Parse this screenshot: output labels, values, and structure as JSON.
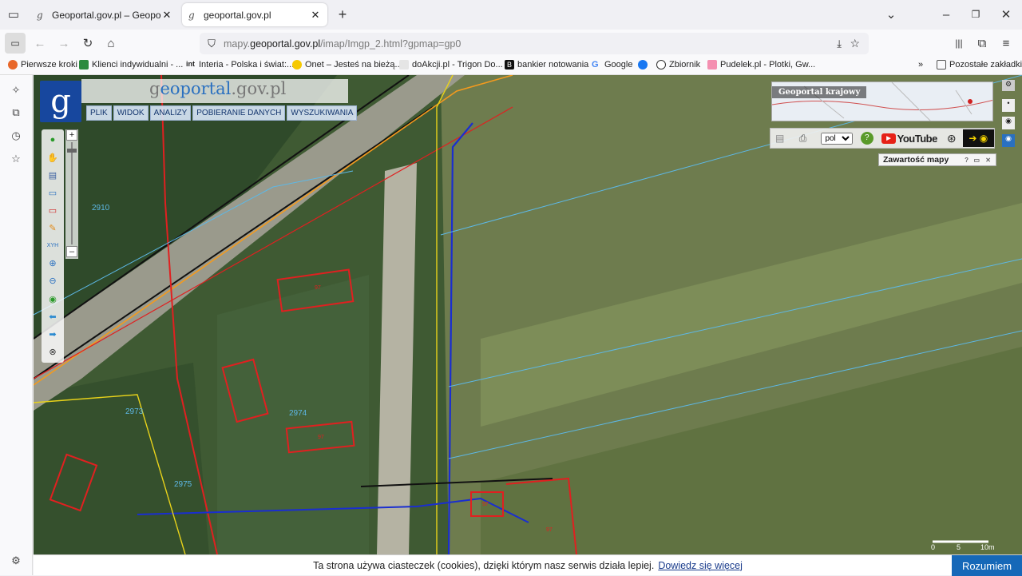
{
  "browser": {
    "tabs": [
      {
        "title": "Geoportal.gov.pl – Geoportal In"
      },
      {
        "title": "geoportal.gov.pl"
      }
    ],
    "url": {
      "prefix": "mapy.",
      "domain": "geoportal.gov.pl",
      "path": "/imap/Imgp_2.html?gpmap=gp0"
    },
    "bookmarks": [
      "Pierwsze kroki",
      "Klienci indywidualni - ...",
      "Interia - Polska i świat:...",
      "Onet – Jesteś na bieżą...",
      "doAkcji.pl - Trigon Do...",
      "bankier notowania",
      "Google",
      "Zbiornik",
      "Pudelek.pl - Plotki, Gw...",
      "Pozostałe zakładki"
    ]
  },
  "geoportal": {
    "logo_letter": "g",
    "title": {
      "g": "g",
      "b": "eoportal",
      "rest": ".gov.pl"
    },
    "menu": [
      "PLIK",
      "WIDOK",
      "ANALIZY",
      "POBIERANIE DANYCH",
      "WYSZUKIWANIA"
    ],
    "overview_title": "Geoportal krajowy",
    "language": "pol",
    "youtube": "YouTube",
    "content_panel": "Zawartość mapy",
    "parcels": [
      "2910",
      "2973",
      "2974",
      "2975"
    ],
    "parcel_symbol": "97",
    "scale": [
      "0",
      "5",
      "10m"
    ]
  },
  "cookie": {
    "text": "Ta strona używa ciasteczek (cookies), dzięki którym nasz serwis działa lepiej.",
    "link": "Dowiedz się więcej",
    "button": "Rozumiem"
  },
  "colors": {
    "brand": "#17479e",
    "accent": "#1668b8"
  }
}
